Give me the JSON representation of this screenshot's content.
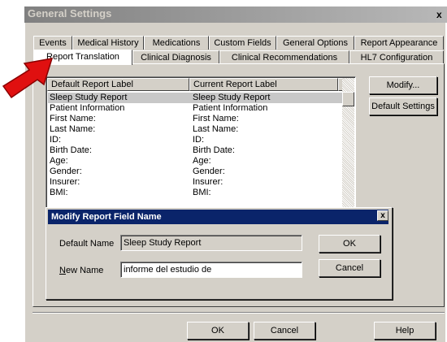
{
  "window": {
    "title": "General Settings",
    "close_glyph": "x"
  },
  "tabs_row1": [
    "Events",
    "Medical History",
    "Medications",
    "Custom Fields",
    "General Options",
    "Report Appearance"
  ],
  "tabs_row2": [
    "Report Translation",
    "Clinical Diagnosis",
    "Clinical Recommendations",
    "HL7 Configuration"
  ],
  "active_tab": "Report Translation",
  "list": {
    "columns": [
      "Default Report Label",
      "Current Report Label"
    ],
    "rows": [
      [
        "Sleep Study Report",
        "Sleep Study Report"
      ],
      [
        "Patient Information",
        "Patient Information"
      ],
      [
        "First Name:",
        "First Name:"
      ],
      [
        "Last Name:",
        "Last Name:"
      ],
      [
        "ID:",
        "ID:"
      ],
      [
        "Birth Date:",
        "Birth Date:"
      ],
      [
        "Age:",
        "Age:"
      ],
      [
        "Gender:",
        "Gender:"
      ],
      [
        "Insurer:",
        "Insurer:"
      ],
      [
        "BMI:",
        "BMI:"
      ]
    ],
    "selected_index": 0
  },
  "side_buttons": {
    "modify": "Modify...",
    "default_settings": "Default Settings"
  },
  "dialog": {
    "title": "Modify Report Field Name",
    "close_glyph": "x",
    "default_name_label": "Default Name",
    "default_name_value": "Sleep Study Report",
    "new_name_label_underlined": "N",
    "new_name_label_rest": "ew Name",
    "new_name_value": "informe del estudio de",
    "ok": "OK",
    "cancel": "Cancel"
  },
  "footer": {
    "ok": "OK",
    "cancel": "Cancel",
    "help": "Help"
  },
  "annotation": {
    "arrow_color": "#e01010"
  }
}
